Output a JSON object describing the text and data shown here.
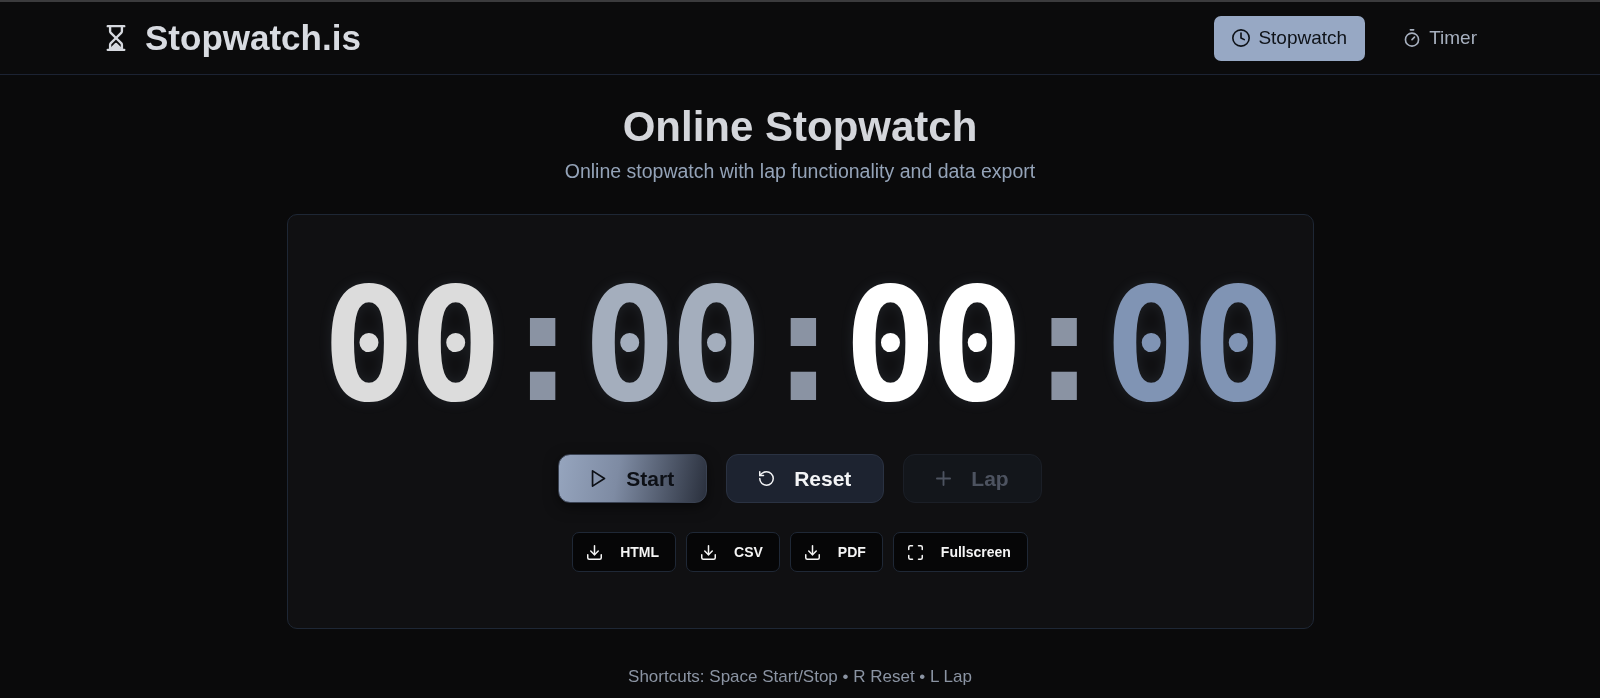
{
  "header": {
    "logo": "Stopwatch.is",
    "nav": [
      {
        "label": "Stopwatch",
        "kind": "stopwatch",
        "selected": true
      },
      {
        "label": "Timer",
        "kind": "timer",
        "selected": false
      }
    ]
  },
  "heading": {
    "title": "Online Stopwatch",
    "subtitle": "Online stopwatch with lap functionality and data export"
  },
  "display": {
    "segments": [
      {
        "value": "00",
        "color": "#dcdcdc"
      },
      {
        "value": "00",
        "color": "#a4aebd"
      },
      {
        "value": "00",
        "color": "#ffffff"
      },
      {
        "value": "00",
        "color": "#8094b4"
      }
    ],
    "separators": [
      ":",
      ":",
      ":"
    ]
  },
  "controls": [
    {
      "label": "Start",
      "kind": "start",
      "disabled": false
    },
    {
      "label": "Reset",
      "kind": "reset",
      "disabled": false
    },
    {
      "label": "Lap",
      "kind": "lap",
      "disabled": true
    }
  ],
  "exports": [
    {
      "label": "HTML",
      "kind": "download"
    },
    {
      "label": "CSV",
      "kind": "download"
    },
    {
      "label": "PDF",
      "kind": "download"
    },
    {
      "label": "Fullscreen",
      "kind": "fullscreen"
    }
  ],
  "shortcuts": "Shortcuts: Space Start/Stop • R Reset • L Lap"
}
